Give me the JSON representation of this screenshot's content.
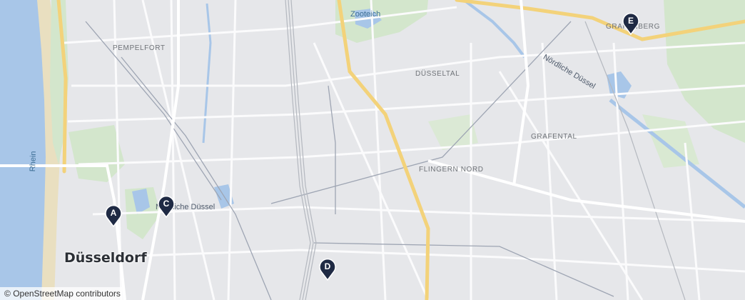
{
  "map": {
    "city": "Düsseldorf",
    "districts": [
      "PEMPELFORT",
      "DÜSSELTAL",
      "GRAFENTAL",
      "FLINGERN NORD",
      "GRAFENBERG"
    ],
    "streets": [
      "Nördliche Düssel",
      "Nördliche Düssel"
    ],
    "water": [
      "Rhein",
      "Zooteich"
    ],
    "colors": {
      "water": "#a8c6e8",
      "park": "#d3e6cc",
      "major_road": "#f3d27a",
      "marker": "#1f2a44"
    }
  },
  "markers": [
    {
      "label": "A",
      "icon": "map-pin-icon"
    },
    {
      "label": "C",
      "icon": "map-pin-icon"
    },
    {
      "label": "D",
      "icon": "map-pin-icon"
    },
    {
      "label": "E",
      "icon": "map-pin-icon"
    }
  ],
  "attribution": {
    "symbol": "©",
    "text": "OpenStreetMap contributors"
  }
}
